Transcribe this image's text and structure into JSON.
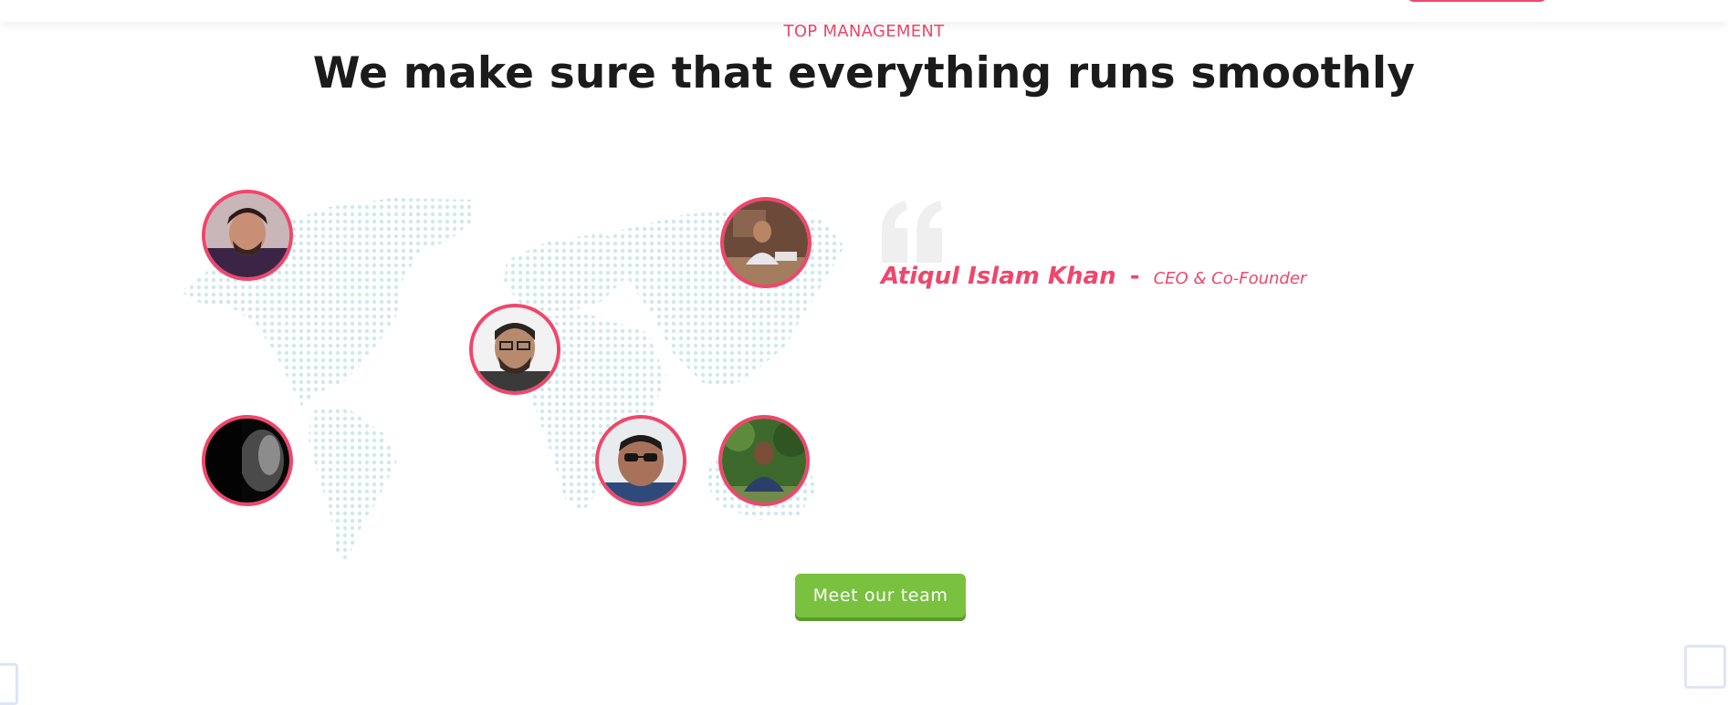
{
  "section": {
    "eyebrow": "TOP MANAGEMENT",
    "headline": "We make sure that everything runs smoothly"
  },
  "team": {
    "featured": {
      "name": "Atiqul Islam Khan",
      "separator": "-",
      "role": "CEO & Co-Founder"
    },
    "members": [
      {
        "id": 1,
        "photo": "man-with-beard"
      },
      {
        "id": 2,
        "photo": "man-at-desk"
      },
      {
        "id": 3,
        "photo": "man-with-glasses"
      },
      {
        "id": 4,
        "photo": "man-in-shadow"
      },
      {
        "id": 5,
        "photo": "man-with-sunglasses"
      },
      {
        "id": 6,
        "photo": "man-outdoors"
      }
    ]
  },
  "cta": {
    "label": "Meet our team"
  },
  "colors": {
    "accent": "#f0466b",
    "cta": "#79c13f",
    "map_dots": "#cfe8ee",
    "heading": "#1b1b1b"
  }
}
